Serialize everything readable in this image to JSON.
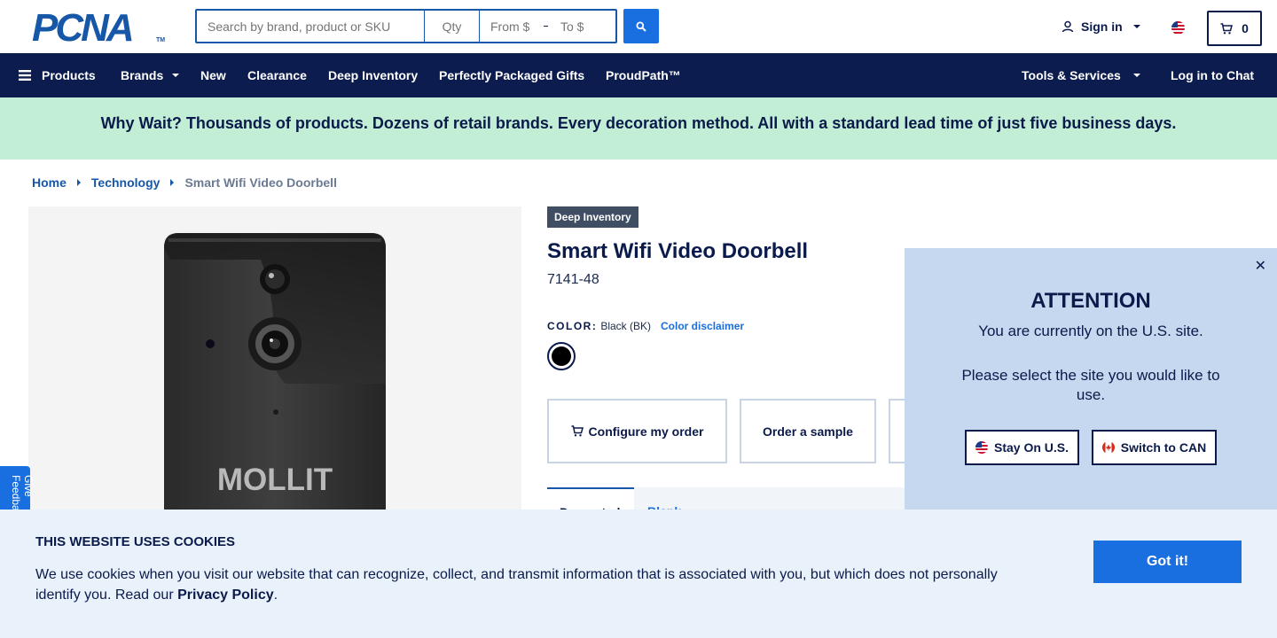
{
  "brand": {
    "logo_text": "PCNA",
    "trademark": "TM"
  },
  "search": {
    "placeholder": "Search by brand, product or SKU",
    "qty_placeholder": "Qty",
    "from_placeholder": "From $",
    "to_placeholder": "To $",
    "button_icon": "search-icon"
  },
  "account": {
    "signin_label": "Sign in",
    "region_flag": "us-flag-icon",
    "cart_count": "0"
  },
  "nav": {
    "items": [
      {
        "label": "Products"
      },
      {
        "label": "Brands"
      },
      {
        "label": "New"
      },
      {
        "label": "Clearance"
      },
      {
        "label": "Deep Inventory"
      },
      {
        "label": "Perfectly Packaged Gifts"
      },
      {
        "label": "ProudPath™"
      }
    ],
    "tools_label": "Tools & Services",
    "chat_label": "Log in to Chat"
  },
  "promo": {
    "text": "Why Wait? Thousands of products. Dozens of retail brands. Every decoration method. All with a standard lead time of just five business days."
  },
  "breadcrumb": {
    "items": [
      "Home",
      "Technology"
    ],
    "current": "Smart Wifi Video Doorbell"
  },
  "product": {
    "badge": "Deep Inventory",
    "title": "Smart Wifi Video Doorbell",
    "sku": "7141-48",
    "color_label": "COLOR:",
    "color_value": "Black (BK)",
    "color_disclaimer": "Color disclaimer",
    "image_brand_text": "MOLLIT",
    "actions": {
      "configure": "Configure my order",
      "sample": "Order a sample"
    },
    "tabs": {
      "active": "Decorated",
      "second": "Blank"
    }
  },
  "feedback": {
    "label": "Give Feedback"
  },
  "attention": {
    "title": "ATTENTION",
    "line1": "You are currently on the U.S. site.",
    "line2": "Please select the site you would like to use.",
    "stay_label": "Stay On U.S.",
    "switch_label": "Switch to CAN"
  },
  "cookie": {
    "title": "THIS WEBSITE USES COOKIES",
    "text": "We use cookies when you visit our website that can recognize, collect, and transmit information that is associated with you, but which does not personally identify you. Read our ",
    "link": "Privacy Policy",
    "period": ".",
    "button": "Got it!"
  },
  "colors": {
    "navy": "#0c1c4e",
    "accent_blue": "#1a6fe0",
    "promo_green": "#c3eed6",
    "modal_blue": "#c5d8ef",
    "cookie_bg": "#e9f1fb"
  }
}
